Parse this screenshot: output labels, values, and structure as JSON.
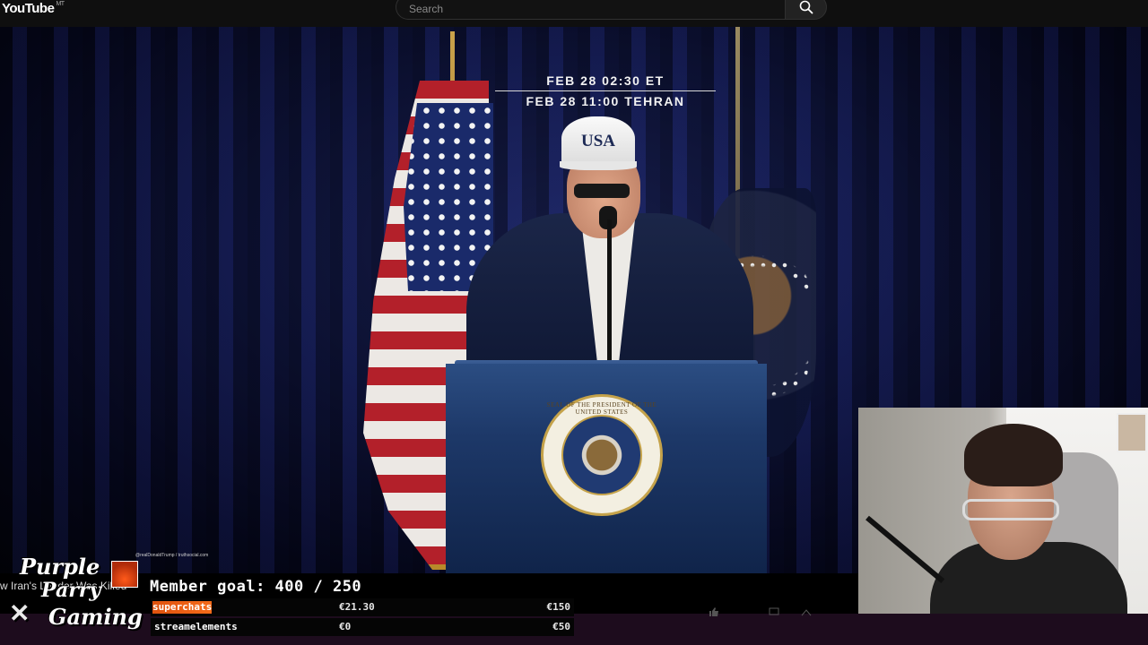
{
  "header": {
    "logo": "YouTube",
    "logo_region": "MT",
    "search_placeholder": "Search",
    "icons": {
      "search": "search-icon"
    }
  },
  "video": {
    "timestamp_line1": "FEB 28 02:30 ET",
    "timestamp_line2": "FEB 28 11:00 TEHRAN",
    "cap_text": "USA",
    "seal_text": "SEAL OF THE PRESIDENT OF THE UNITED STATES",
    "credit": "@realDonaldTrump / truthsocial.com"
  },
  "overlay": {
    "logo_lines": [
      "Purple",
      "Parry",
      "Gaming"
    ],
    "ticker": "w Iran's Leader Was Killed",
    "member_goal": "Member goal: 400 / 250",
    "donations": [
      {
        "name": "superchats",
        "amount": "€21.30",
        "goal": "€150"
      },
      {
        "name": "streamelements",
        "amount": "€0",
        "goal": "€50"
      }
    ]
  },
  "colors": {
    "accent": "#f56b19",
    "background": "#0f0f0f",
    "curtain": "#101642"
  }
}
